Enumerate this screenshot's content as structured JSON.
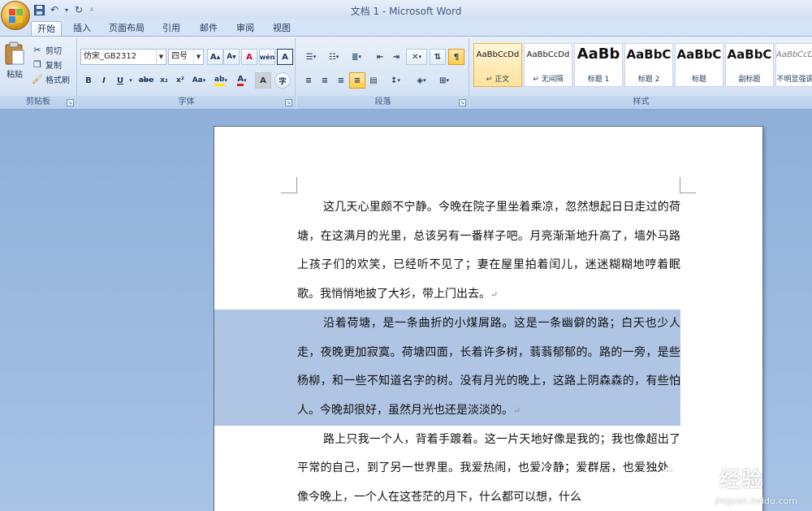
{
  "window": {
    "title": "文档 1 - Microsoft Word"
  },
  "tabs": [
    {
      "label": "开始",
      "active": true
    },
    {
      "label": "插入"
    },
    {
      "label": "页面布局"
    },
    {
      "label": "引用"
    },
    {
      "label": "邮件"
    },
    {
      "label": "审阅"
    },
    {
      "label": "视图"
    }
  ],
  "clipboard": {
    "paste": "粘贴",
    "cut": "剪切",
    "copy": "复制",
    "format_painter": "格式刷",
    "label": "剪贴板"
  },
  "font": {
    "name": "仿宋_GB2312",
    "size": "四号",
    "label": "字体",
    "phonetic": "wén",
    "char_border": "A",
    "grow": "A",
    "shrink": "A",
    "clear": "A",
    "bold": "B",
    "italic": "I",
    "underline": "U",
    "strike": "abe",
    "subscript": "x₂",
    "superscript": "x²",
    "change_case": "Aa",
    "highlight": "ab",
    "font_color": "A",
    "char_shading": "A",
    "enclose": "字"
  },
  "paragraph": {
    "label": "段落"
  },
  "styles": {
    "label": "样式",
    "items": [
      {
        "sample": "AaBbCcDd",
        "name": "↵ 正文",
        "selected": true
      },
      {
        "sample": "AaBbCcDd",
        "name": "↵ 无间隔"
      },
      {
        "sample": "AaBb",
        "name": "标题 1"
      },
      {
        "sample": "AaBbC",
        "name": "标题 2"
      },
      {
        "sample": "AaBbC",
        "name": "标题"
      },
      {
        "sample": "AaBbC",
        "name": "副标题"
      },
      {
        "sample": "AaBbCcDd",
        "name": "不明显强调"
      }
    ]
  },
  "document": {
    "paragraphs": [
      {
        "text": "这几天心里颇不宁静。今晚在院子里坐着乘凉，忽然想起日日走过的荷塘，在这满月的光里，总该另有一番样子吧。月亮渐渐地升高了，墙外马路上孩子们的欢笑，已经听不见了；妻在屋里拍着闰儿，迷迷糊糊地哼着眠歌。我悄悄地披了大衫，带上门出去。",
        "selected": false
      },
      {
        "text": "沿着荷塘，是一条曲折的小煤屑路。这是一条幽僻的路；白天也少人走，夜晚更加寂寞。荷塘四面，长着许多树，蓊蓊郁郁的。路的一旁，是些杨柳，和一些不知道名字的树。没有月光的晚上，这路上阴森森的，有些怕人。今晚却很好，虽然月光也还是淡淡的。",
        "selected": true
      },
      {
        "text": "路上只我一个人，背着手踱着。这一片天地好像是我的；我也像超出了平常的自己，到了另一世界里。我爱热闹，也爱冷静；爱群居，也爱独处。像今晚上，一个人在这苍茫的月下，什么都可以想，什么",
        "selected": false
      }
    ],
    "para_mark": "↵"
  },
  "watermark": {
    "brand": "经验",
    "url": "jingyan.baidu.com"
  }
}
